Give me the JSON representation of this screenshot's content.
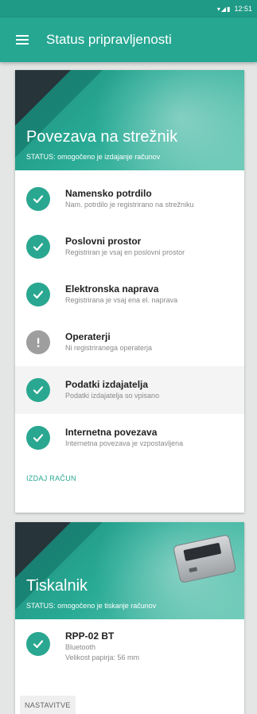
{
  "status_bar": {
    "time": "12:51",
    "icons": [
      "wifi-icon",
      "signal-icon",
      "battery-icon"
    ]
  },
  "app_bar": {
    "title": "Status pripravljenosti",
    "menu_icon": "hamburger-menu-icon"
  },
  "colors": {
    "primary": "#26a792",
    "status_bar": "#1e9a86",
    "ok": "#2aa790",
    "warning": "#9e9e9e"
  },
  "server_card": {
    "title": "Povezava na strežnik",
    "status": "STATUS: omogočeno je izdajanje računov",
    "items": [
      {
        "title": "Namensko potrdilo",
        "subtitle": "Nam. potrdilo je registrirano na strežniku",
        "state": "ok"
      },
      {
        "title": "Poslovni prostor",
        "subtitle": "Registriran je vsaj en poslovni prostor",
        "state": "ok"
      },
      {
        "title": "Elektronska naprava",
        "subtitle": "Registrirana je vsaj ena el. naprava",
        "state": "ok"
      },
      {
        "title": "Operaterji",
        "subtitle": "Ni registriranega operaterja",
        "state": "warning"
      },
      {
        "title": "Podatki izdajatelja",
        "subtitle": "Podatki izdajatelja so vpisano",
        "state": "ok"
      },
      {
        "title": "Internetna povezava",
        "subtitle": "Internetna povezava je vzpostavljena",
        "state": "ok"
      }
    ],
    "action_label": "IZDAJ RAČUN"
  },
  "printer_card": {
    "title": "Tiskalnik",
    "status": "STATUS: omogočeno je tiskanje računov",
    "device": {
      "name": "RPP-02 BT",
      "connection": "Bluetooth",
      "paper": "Velikost papirja: 56 mm",
      "state": "ok"
    },
    "settings_label": "NASTAVITVE"
  }
}
